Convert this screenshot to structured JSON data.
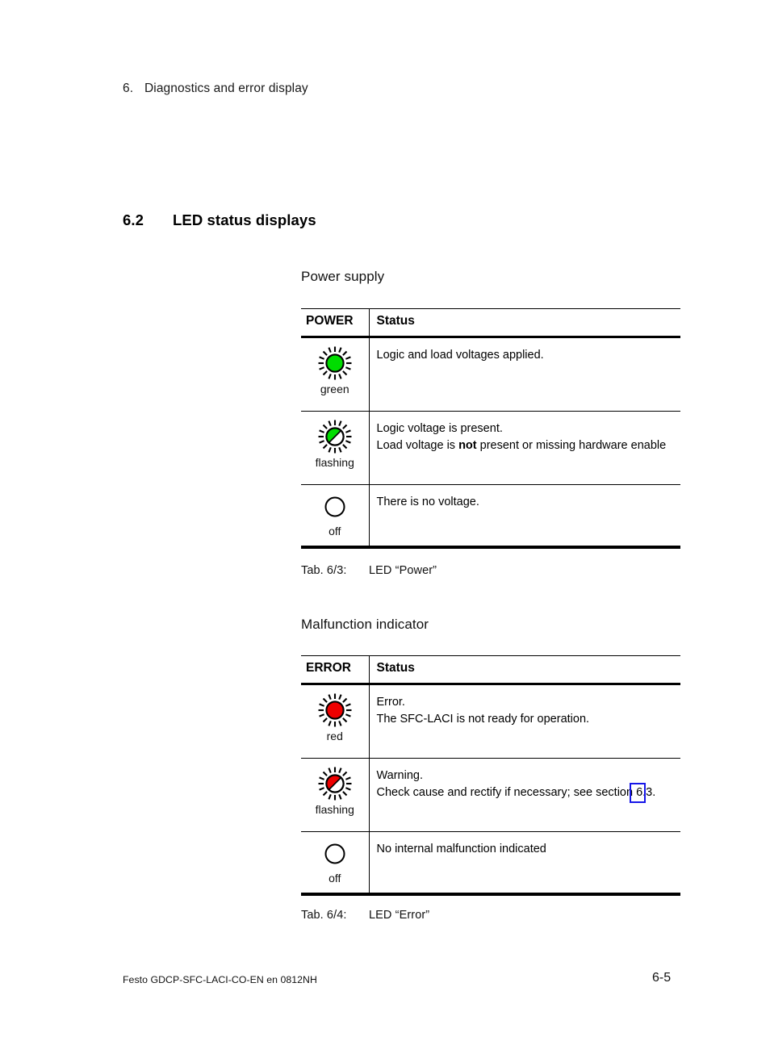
{
  "running_head": {
    "number": "6.",
    "title": "Diagnostics and error display"
  },
  "section": {
    "number": "6.2",
    "title": "LED status displays"
  },
  "colors": {
    "led_green": "#00dd00",
    "led_red": "#ee0000",
    "link_box_border": "#1616e8",
    "rule": "#000000"
  },
  "power_block": {
    "sub_heading": "Power supply",
    "table": {
      "headers": [
        "POWER",
        "Status"
      ],
      "rows": [
        {
          "icon": "led-lit-green-icon",
          "icon_label": "green",
          "status_lines": [
            {
              "text": "Logic and load voltages applied."
            }
          ]
        },
        {
          "icon": "led-flashing-green-icon",
          "icon_label": "flashing",
          "status_lines": [
            {
              "text": "Logic voltage is present."
            },
            {
              "pre": "Load voltage is ",
              "bold": "not",
              "post": " present or missing hardware enable"
            }
          ]
        },
        {
          "icon": "led-off-icon",
          "icon_label": "off",
          "status_lines": [
            {
              "text": "There is no voltage."
            }
          ]
        }
      ]
    },
    "caption": {
      "number": "Tab. 6/3:",
      "text": "LED “Power”"
    }
  },
  "error_block": {
    "sub_heading": "Malfunction indicator",
    "table": {
      "headers": [
        "ERROR",
        "Status"
      ],
      "rows": [
        {
          "icon": "led-lit-red-icon",
          "icon_label": "red",
          "status_lines": [
            {
              "text": "Error."
            },
            {
              "text": "The SFC-LACI is not ready for operation."
            }
          ]
        },
        {
          "icon": "led-flashing-red-icon",
          "icon_label": "flashing",
          "status_lines": [
            {
              "text": "Warning."
            },
            {
              "text": "Check cause and rectify if necessary; see section 6.3."
            }
          ]
        },
        {
          "icon": "led-off-icon",
          "icon_label": "off",
          "status_lines": [
            {
              "text": "No internal malfunction indicated"
            }
          ]
        }
      ]
    },
    "caption": {
      "number": "Tab. 6/4:",
      "text": "LED “Error”"
    }
  },
  "annotation": {
    "link_box_label": "cross-reference-link-6.3"
  },
  "footer": {
    "left": "Festo GDCP-SFC-LACI-CO-EN  en 0812NH",
    "page_number": "6-5"
  }
}
